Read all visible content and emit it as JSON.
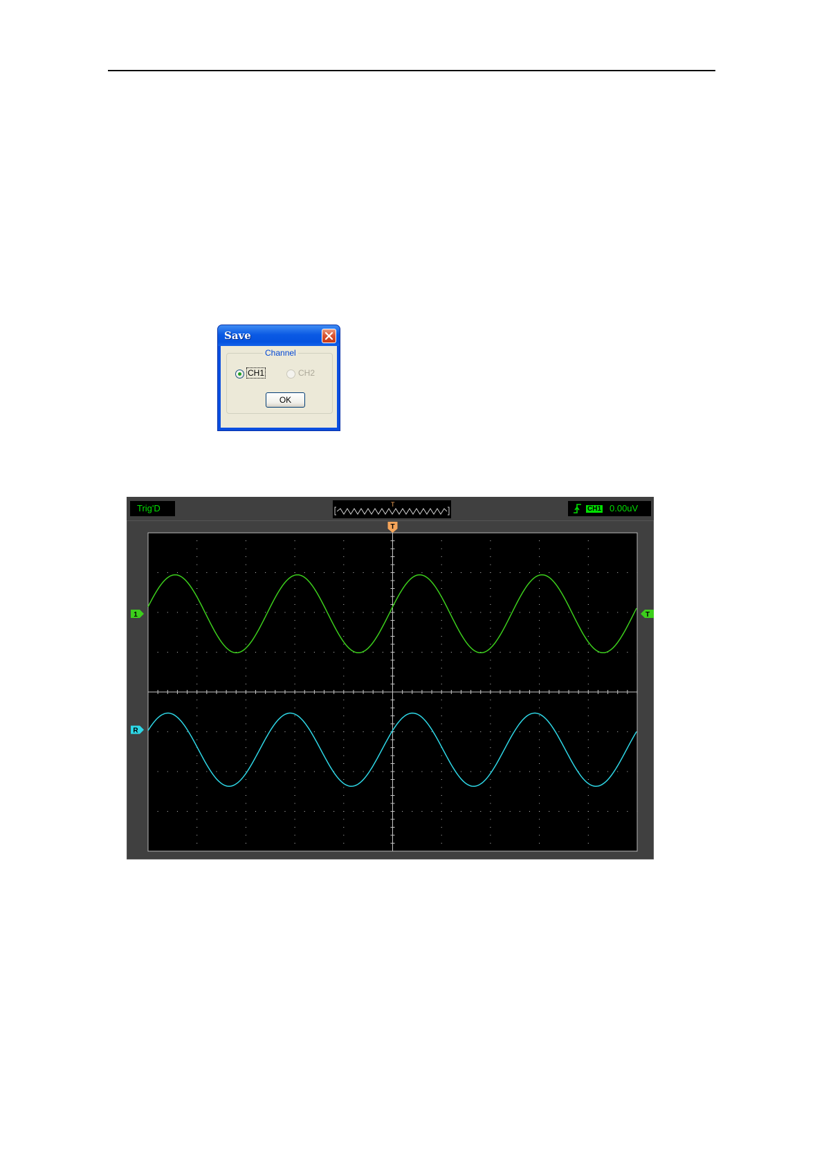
{
  "dialog": {
    "title": "Save",
    "group_label": "Channel",
    "options": [
      {
        "label": "CH1",
        "selected": true,
        "enabled": true
      },
      {
        "label": "CH2",
        "selected": false,
        "enabled": false
      }
    ],
    "ok_label": "OK"
  },
  "scope": {
    "status": "Trig'D",
    "trigger_marker": "T",
    "trigger_channel": "CH1",
    "trigger_level": "0.00uV",
    "ch1_marker": "1",
    "ref_marker": "R",
    "level_marker": "T",
    "colors": {
      "ch1": "#3ccf1c",
      "ref": "#2ed7e6",
      "trigger": "#f5a55a",
      "grid": "#c8c8c8",
      "frame": "#404040"
    }
  }
}
